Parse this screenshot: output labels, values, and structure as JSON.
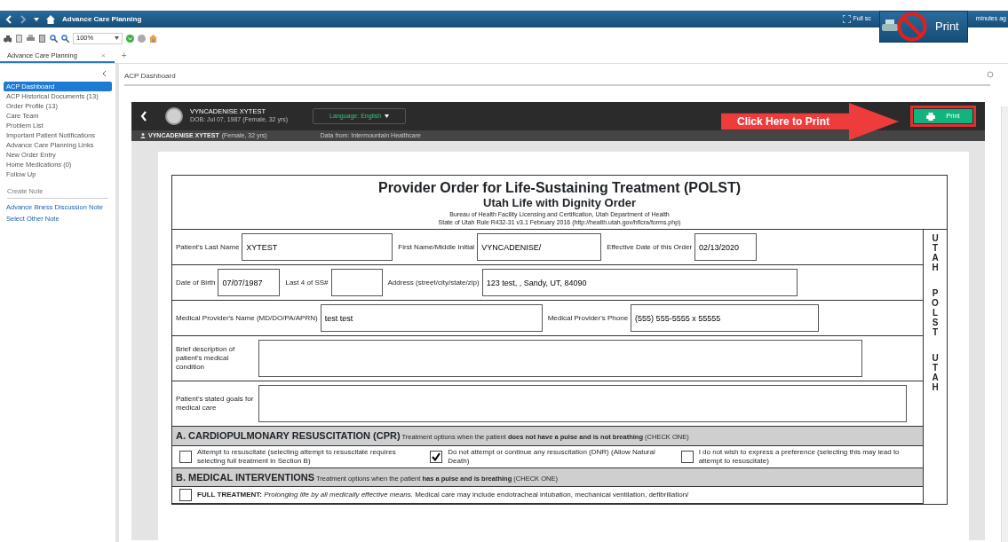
{
  "window": {
    "title": "Advance Care Planning",
    "right_texts": [
      "Full sc",
      "minutes ag"
    ]
  },
  "print_overlay": {
    "label": "Print"
  },
  "toolbar": {
    "zoom": "100%"
  },
  "tabs": [
    {
      "label": "Advance Care Planning",
      "selected": true,
      "close": "×"
    },
    {
      "label": "+",
      "selected": false
    }
  ],
  "sidebar": {
    "items": [
      {
        "label": "ACP Dashboard",
        "selected": true
      },
      {
        "label": "ACP Historical Documents (13)",
        "selected": false
      },
      {
        "label": "Order Profile (13)",
        "selected": false
      },
      {
        "label": "Care Team",
        "selected": false
      },
      {
        "label": "Problem List",
        "selected": false
      },
      {
        "label": "Important Patient Notifications",
        "selected": false
      },
      {
        "label": "Advance Care Planning Links",
        "selected": false
      },
      {
        "label": "New Order Entry",
        "selected": false
      },
      {
        "label": "Home Medications (0)",
        "selected": false
      },
      {
        "label": "Follow Up",
        "selected": false
      }
    ],
    "note_heading": "Create Note",
    "note_links": [
      "Advance Illness Discussion Note",
      "Select Other Note"
    ]
  },
  "page_title": "ACP Dashboard",
  "patient": {
    "name": "VYNCADENISE XYTEST",
    "dob": "DOB: Jul 07, 1987 (Female, 32 yrs)",
    "language": "Language: English",
    "banner_name": "VYNCADENISE XYTEST",
    "banner_info": "(Female, 32 yrs)",
    "source": "Data from: Intermountain Healthcare",
    "print": "Print"
  },
  "callout": "Click Here to Print",
  "form": {
    "title": "Provider Order for Life-Sustaining Treatment (POLST)",
    "subtitle": "Utah Life with Dignity Order",
    "agency": "Bureau of Health Facility Licensing and Certification, Utah Department of Health",
    "rule": "State of Utah Rule R432-31 v3.1 February 2016 (http://health.utah.gov/hflcra/forms.php)",
    "rows": [
      {
        "fields": [
          {
            "label": "Patient's Last Name",
            "value": "XYTEST"
          },
          {
            "label": "First Name/Middle Initial",
            "value": "VYNCADENISE/"
          },
          {
            "label": "Effective Date of this Order",
            "value": "02/13/2020"
          }
        ]
      },
      {
        "fields": [
          {
            "label": "Date of Birth",
            "value": "07/07/1987"
          },
          {
            "label": "Last 4 of SS#"
          },
          {
            "label": "Address (street/city/state/zip)",
            "value": "123 test, , Sandy, UT, 84090"
          }
        ]
      },
      {
        "fields": [
          {
            "label": "Medical Provider's Name (MD/DO/PA/APRN)",
            "value": "test test"
          },
          {
            "label": "Medical Provider's Phone",
            "value": "(555) 555-5555 x 55555"
          }
        ]
      },
      {
        "fields": [
          {
            "label": "Brief description of patient's medical condition"
          }
        ]
      },
      {
        "fields": [
          {
            "label": "Patient's stated goals for medical care"
          }
        ]
      }
    ],
    "sections": [
      {
        "title": "A.  CARDIOPULMONARY RESUSCITATION (CPR)",
        "note": "Treatment options when the patient **does not have a pulse and is not breathing** (CHECK ONE)",
        "options": [
          {
            "label": "Attempt to resuscitate (selecting attempt to resuscitate requires selecting full treatment in Section B)",
            "checked": false
          },
          {
            "label": "Do not attempt or continue any resuscitation (DNR) (Allow Natural Death)",
            "checked": true
          },
          {
            "label": "I do not wish to express a preference   (selecting this may lead to attempt to resuscitate)",
            "checked": false
          }
        ]
      },
      {
        "title": "B.  MEDICAL INTERVENTIONS",
        "note": "Treatment options when the patient **has a pulse and is breathing** (CHECK ONE)",
        "options": [
          {
            "label": "**FULL TREATMENT:** *Prolonging life by all medically effective means.* Medical care may include endotracheal intubation, mechanical ventilation, defibrillation/",
            "checked": false
          }
        ]
      }
    ],
    "side_words": [
      "UTAH",
      "POLST",
      "UTAH"
    ]
  }
}
